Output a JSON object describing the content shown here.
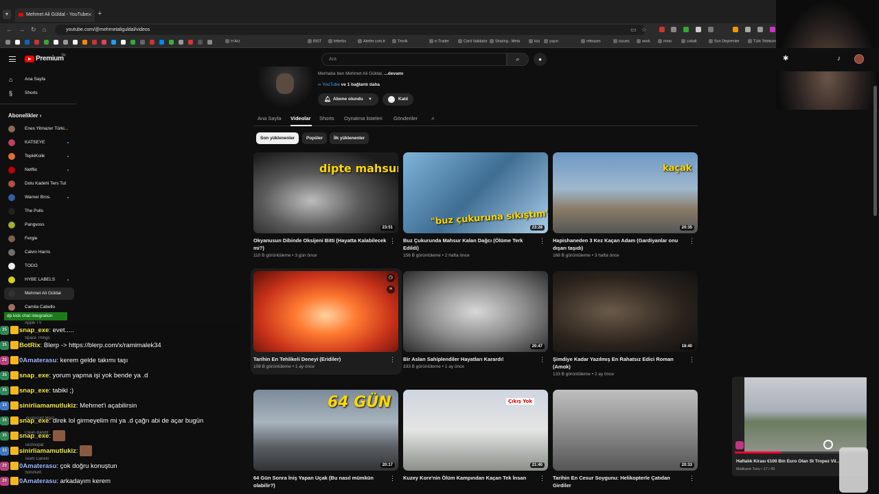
{
  "browser": {
    "tab_title": "Mehmet Ali Güldal - YouTube",
    "url": "youtube.com/@mehmetaliguldal/videos",
    "bookmarks": [
      "H Arz",
      "BIST",
      "letterbx",
      "Aletler.com.tr",
      "Teorik",
      "e-Trader",
      "Card Validator",
      "Sharing - Meta",
      "kss",
      "yayın",
      "releases",
      "issues",
      "work",
      "mmo",
      "cobalt",
      "Son Depremler",
      "Türk Telekom"
    ]
  },
  "yt": {
    "brand": "Premium",
    "brand_sup": "TR",
    "search_placeholder": "Ara"
  },
  "sidebar": {
    "home": "Ana Sayfa",
    "shorts": "Shorts",
    "subs_header": "Abonelikler",
    "subs": [
      {
        "label": "Enes Yilmazer Türki...",
        "color": "#8a6a50",
        "dot": false
      },
      {
        "label": "KATSEYE",
        "color": "#c04060",
        "dot": true
      },
      {
        "label": "TepkiKolik",
        "color": "#e07030",
        "dot": true
      },
      {
        "label": "Netflix",
        "color": "#c00000",
        "dot": true
      },
      {
        "label": "Dolu Kadehi Ters Tut",
        "color": "#b05040",
        "dot": false
      },
      {
        "label": "Warner Bros.",
        "color": "#3060a0",
        "dot": true
      },
      {
        "label": "The Polls",
        "color": "#222",
        "dot": false
      },
      {
        "label": "Pangvoss",
        "color": "#a0b030",
        "dot": false
      },
      {
        "label": "Fergie",
        "color": "#806050",
        "dot": false
      },
      {
        "label": "Calvin Harris",
        "color": "#707070",
        "dot": false
      },
      {
        "label": "TODO",
        "color": "#eeeeee",
        "dot": false
      },
      {
        "label": "HYBE LABELS",
        "color": "#d0d020",
        "dot": true
      },
      {
        "label": "Mehmet Ali Güldal",
        "color": "#333",
        "dot": false
      },
      {
        "label": "Camila Cabello",
        "color": "#a07060",
        "dot": false
      }
    ]
  },
  "channel": {
    "desc_prefix": "Merhaba ben Mehmet Ali Güldal, ",
    "desc_more": "...devamı",
    "link": "YouTube",
    "link_more": " ve 1 bağlantı daha",
    "subscribed": "Abone olundu",
    "join": "Katıl",
    "tabs": [
      "Ana Sayfa",
      "Videolar",
      "Shorts",
      "Oynatma listeleri",
      "Gönderiler"
    ],
    "chips": [
      "Son yüklenenler",
      "Popüler",
      "İlk yüklenenler"
    ]
  },
  "videos": [
    {
      "title": "Okyanusun Dibinde Oksijeni Bitti (Hayatta Kalabilecek mi?)",
      "meta": "110 B görüntüleme • 3 gün önce",
      "duration": "23:51",
      "overlay": "dipte mahsur"
    },
    {
      "title": "Buz Çukurunda Mahsur Kalan Dağcı (Ölüme Terk Edildi)",
      "meta": "156 B görüntüleme • 2 hafta önce",
      "duration": "23:28",
      "overlay": "\"buz çukuruna sıkıştım\""
    },
    {
      "title": "Hapishaneden 3 Kez Kaçan Adam (Gardiyanlar onu dışarı taşıdı)",
      "meta": "168 B görüntüleme • 3 hafta önce",
      "duration": "20:35",
      "overlay": "kaçak"
    },
    {
      "title": "Tarihin En Tehlikeli Deneyi (Eridiler)",
      "meta": "108 B görüntüleme • 1 ay önce",
      "duration": "",
      "overlay": ""
    },
    {
      "title": "Bir Aslan Sahiplendiler Hayatları Karardı!",
      "meta": "333 B görüntüleme • 1 ay önce",
      "duration": "20:47",
      "overlay": ""
    },
    {
      "title": "Şimdiye Kadar Yazılmış En Rahatsız Edici Roman (Amok)",
      "meta": "133 B görüntüleme • 2 ay önce",
      "duration": "18:40",
      "overlay": ""
    },
    {
      "title": "64 Gün Sonra İniş Yapan Uçak (Bu nasıl mümkün olabilir?)",
      "meta": "",
      "duration": "20:17",
      "overlay": "64 GÜN"
    },
    {
      "title": "Kuzey Kore'nin Ölüm Kampından Kaçan Tek İnsan",
      "meta": "",
      "duration": "21:40",
      "overlay": "Çıkış Yok"
    },
    {
      "title": "Tarihin En Cesur Soygunu: Helikopterle Çatıdan Girdiler",
      "meta": "",
      "duration": "20:33",
      "overlay": ""
    }
  ],
  "chat": {
    "badge": "dp kick chat integration",
    "ghost_labels": [
      "Apple TV",
      "Space Things",
      "JavaScript Mast...",
      "Clean Bandit",
      "Technopat",
      "Team Canelo",
      "Sorunum"
    ],
    "lines": [
      {
        "months": "35",
        "badge_color": "#2e8b57",
        "user": "snap_exe",
        "user_color": "#f3e94d",
        "text": "evet....."
      },
      {
        "months": "35",
        "badge_color": "#2e8b57",
        "user": "BotRix",
        "user_color": "#f3e94d",
        "text": "Blerp -> https://blerp.com/x/ramimalek34"
      },
      {
        "months": "20",
        "badge_color": "#c04080",
        "user": "0Amaterasu",
        "user_color": "#a0b8ff",
        "text": "kerem gelde takımı taşı"
      },
      {
        "months": "35",
        "badge_color": "#2e8b57",
        "user": "snap_exe",
        "user_color": "#f3e94d",
        "text": "yorum yapma işi yok bende ya .d"
      },
      {
        "months": "35",
        "badge_color": "#2e8b57",
        "user": "snap_exe",
        "user_color": "#f3e94d",
        "text": "tabiki ;)"
      },
      {
        "months": "33",
        "badge_color": "#3a7ad0",
        "user": "sinirliamamutlukiz",
        "user_color": "#f3e94d",
        "text": "Mehmet'i açabilirsin"
      },
      {
        "months": "35",
        "badge_color": "#2e8b57",
        "user": "snap_exe",
        "user_color": "#f3e94d",
        "text": "direk lol girmeyelim mi ya .d çağrı abi de açar bugün"
      },
      {
        "months": "35",
        "badge_color": "#2e8b57",
        "user": "snap_exe",
        "user_color": "#f3e94d",
        "text": ""
      },
      {
        "months": "33",
        "badge_color": "#3a7ad0",
        "user": "sinirliamamutlukiz",
        "user_color": "#f3e94d",
        "text": ""
      },
      {
        "months": "20",
        "badge_color": "#c04080",
        "user": "0Amaterasu",
        "user_color": "#a0b8ff",
        "text": "çok doğru konuştun"
      },
      {
        "months": "20",
        "badge_color": "#c04080",
        "user": "0Amaterasu",
        "user_color": "#a0b8ff",
        "text": "arkadayım kerem"
      }
    ]
  },
  "miniplayer": {
    "title": "Haftalık Kirası €100 Bin Euro Olan St Tropez Vil...",
    "sub": "Malikane Turu • 17 / 43",
    "progress_fraction": 0.35
  }
}
